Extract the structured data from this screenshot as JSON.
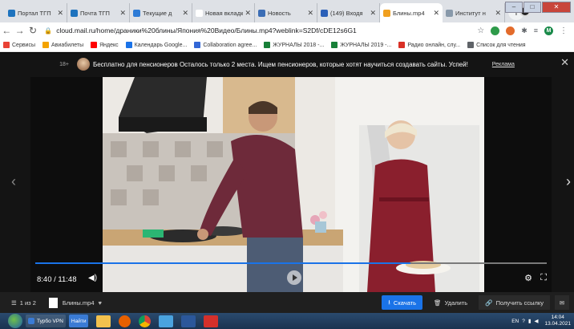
{
  "tabs": [
    {
      "label": "Портал ТГП",
      "color": "#1e73be",
      "active": false
    },
    {
      "label": "Почта ТГП",
      "color": "#1e73be",
      "active": false
    },
    {
      "label": "Текущие д",
      "color": "#2e7bd6",
      "active": false
    },
    {
      "label": "Новая вкладка",
      "color": "#ffffff",
      "active": false
    },
    {
      "label": "Новость",
      "color": "#3b6db5",
      "active": false
    },
    {
      "label": "(149) Входя",
      "color": "#2a5fb8",
      "active": false
    },
    {
      "label": "Блины.mp4",
      "color": "#f0a020",
      "active": true
    },
    {
      "label": "Институт н",
      "color": "#8899aa",
      "active": false
    }
  ],
  "address": {
    "url": "cloud.mail.ru/home/дpaники%20блины/Япония%20Видео/Блины.mp4?weblink=S2Df/cDE12s6G1"
  },
  "bookmarks": [
    {
      "label": "Сервисы",
      "color": "#e94235"
    },
    {
      "label": "Авиабилеты",
      "color": "#f4a300"
    },
    {
      "label": "Яндекс",
      "color": "#ff0000"
    },
    {
      "label": "Календарь Google...",
      "color": "#1a73e8"
    },
    {
      "label": "Collaboration agree...",
      "color": "#3367d6"
    },
    {
      "label": "ЖУРНАЛЫ 2018 -...",
      "color": "#188038"
    },
    {
      "label": "ЖУРНАЛЫ 2019 -...",
      "color": "#188038"
    },
    {
      "label": "Радио онлайн, слу...",
      "color": "#d93025"
    },
    {
      "label": "Список для чтения",
      "color": "#5f6368"
    }
  ],
  "ad": {
    "age": "18+",
    "text": "Бесплатно для пенсионеров   Осталось только 2 места. Ищем пенсионеров, которые хотят научиться создавать сайты. Успей!",
    "link": "Реклама"
  },
  "player": {
    "current_time": "8:40",
    "separator": " / ",
    "duration": "11:48",
    "progress_fraction": 0.733
  },
  "footer": {
    "pages": "1 из 2",
    "filename": "Блины.mp4",
    "download_label": "Скачать",
    "delete_label": "Удалить",
    "link_label": "Получить ссылку"
  },
  "taskbar": {
    "vpn_label": "Турбо VPN",
    "vpn_btn": "Найти",
    "lang": "EN",
    "time": "14:04",
    "date": "13.04.2021"
  }
}
